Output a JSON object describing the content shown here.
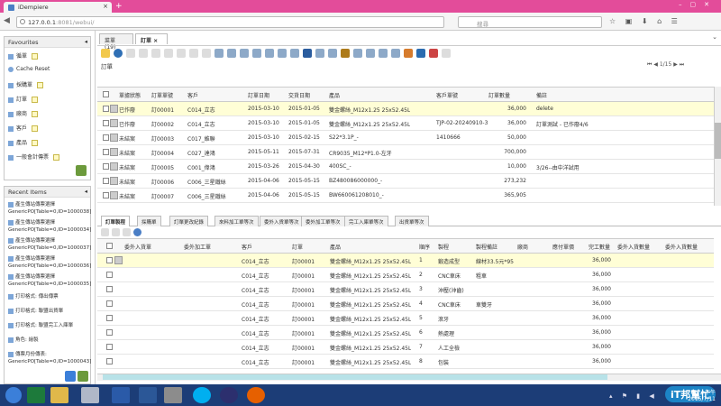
{
  "browser": {
    "tab_title": "iDempiere",
    "url": "127.0.0.1",
    "url_rest": ":8081/webui/",
    "search_placeholder": "搜尋"
  },
  "favourites": {
    "title": "Favourites",
    "items": [
      "循單",
      "Cache Reset",
      "採購單",
      "訂單",
      "廠商",
      "客戶",
      "產品",
      "一般會計傳票"
    ]
  },
  "recent": {
    "title": "Recent Items",
    "items": [
      "產生傳站傳票選擇",
      "GenericPO[Table=0,ID=1000038]",
      "產生傳站傳票選擇",
      "GenericPO[Table=0,ID=1000034]",
      "產生傳站傳票選擇",
      "GenericPO[Table=0,ID=1000037]",
      "產生傳站傳票選擇",
      "GenericPO[Table=0,ID=1000036]",
      "產生傳站傳票選擇",
      "GenericPO[Table=0,ID=1000035]",
      "打印格式: 傳出傳票",
      "打印格式: 聯盟出貨單",
      "打印格式: 聯盟完工入庫單",
      "角色: 繪製",
      "傳票月份傳表:",
      "GenericPO[Table=0,ID=1000043]"
    ]
  },
  "window_tabs": [
    {
      "label": "菜單 (19)"
    },
    {
      "label": "訂單"
    }
  ],
  "window_title": "訂單",
  "pager": "1/15",
  "header_grid": {
    "columns": [
      "單據狀態",
      "訂單單號",
      "客戶",
      "訂單日期",
      "交貨日期",
      "產品",
      "客戶單號",
      "訂單數量",
      "備註"
    ],
    "rows": [
      [
        "已作廢",
        "訂00001",
        "C014_立志",
        "2015-03-10",
        "2015-01-05",
        "雙金螺絲_M12x1.25 25x52.45L",
        "",
        "36,000",
        "delete"
      ],
      [
        "已作廢",
        "訂00002",
        "C014_立志",
        "2015-03-10",
        "2015-01-05",
        "雙金螺絲_M12x1.25 25x52.45L",
        "TJP-02-20240910-3",
        "36,000",
        "訂單測試 - 已作廢4/6"
      ],
      [
        "未結案",
        "訂00003",
        "C017_維聯",
        "2015-03-10",
        "2015-02-15",
        "S22*3.1P_-",
        "1410666",
        "50,000",
        ""
      ],
      [
        "未結案",
        "訂00004",
        "C027_達鴻",
        "2015-05-11",
        "2015-07-31",
        "CR9035_M12*P1.0-左牙",
        "",
        "700,000",
        ""
      ],
      [
        "未結案",
        "訂00005",
        "C001_偉鴻",
        "2015-03-26",
        "2015-04-30",
        "400SC_-",
        "",
        "10,000",
        "3/26--由中洋試用"
      ],
      [
        "未結案",
        "訂00006",
        "C006_三星鐵絲",
        "2015-04-06",
        "2015-05-15",
        "BZ480086000000_-",
        "",
        "273,232",
        ""
      ],
      [
        "未結案",
        "訂00007",
        "C006_三星鐵絲",
        "2015-04-06",
        "2015-05-15",
        "BW660061208010_-",
        "",
        "365,905",
        ""
      ]
    ]
  },
  "detail_tabs": [
    "訂單製程",
    "採購單",
    "訂單更改紀錄",
    "來料加工單等次",
    "委外入貨單等次",
    "委外加工單等次",
    "完工入庫單等次",
    "出貨單等次"
  ],
  "detail_grid": {
    "columns": [
      "委外入貨單",
      "委外加工單",
      "客戶",
      "訂單",
      "產品",
      "順序",
      "製程",
      "製程備註",
      "廠商",
      "應付單價",
      "完工數量",
      "委外入貨數量",
      "委外入貨數量"
    ],
    "rows": [
      [
        "",
        "",
        "C014_立志",
        "訂00001",
        "雙金螺絲_M12x1.25 25x52.45L",
        "1",
        "鍛造成型",
        "線材33.5元*95",
        "",
        "",
        "36,000",
        "",
        ""
      ],
      [
        "",
        "",
        "C014_立志",
        "訂00001",
        "雙金螺絲_M12x1.25 25x52.45L",
        "2",
        "CNC車床",
        "粗車",
        "",
        "",
        "36,000",
        "",
        ""
      ],
      [
        "",
        "",
        "C014_立志",
        "訂00001",
        "雙金螺絲_M12x1.25 25x52.45L",
        "3",
        "沖壓(沖齒)",
        "",
        "",
        "",
        "36,000",
        "",
        ""
      ],
      [
        "",
        "",
        "C014_立志",
        "訂00001",
        "雙金螺絲_M12x1.25 25x52.45L",
        "4",
        "CNC車床",
        "車雙牙",
        "",
        "",
        "36,000",
        "",
        ""
      ],
      [
        "",
        "",
        "C014_立志",
        "訂00001",
        "雙金螺絲_M12x1.25 25x52.45L",
        "5",
        "滾牙",
        "",
        "",
        "",
        "36,000",
        "",
        ""
      ],
      [
        "",
        "",
        "C014_立志",
        "訂00001",
        "雙金螺絲_M12x1.25 25x52.45L",
        "6",
        "熱處理",
        "",
        "",
        "",
        "36,000",
        "",
        ""
      ],
      [
        "",
        "",
        "C014_立志",
        "訂00001",
        "雙金螺絲_M12x1.25 25x52.45L",
        "7",
        "人工全檢",
        "",
        "",
        "",
        "36,000",
        "",
        ""
      ],
      [
        "",
        "",
        "C014_立志",
        "訂00001",
        "雙金螺絲_M12x1.25 25x52.45L",
        "8",
        "包裝",
        "",
        "",
        "",
        "36,000",
        "",
        ""
      ]
    ]
  },
  "clock": {
    "time": "下午 ",
    "date": "2015/7/11"
  },
  "logo": "iT邦幫忙"
}
